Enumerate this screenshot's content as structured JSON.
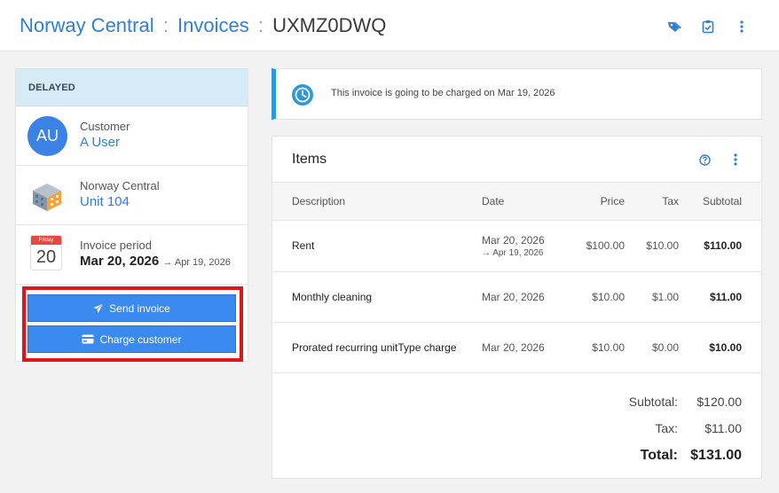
{
  "header": {
    "crumb_property": "Norway Central",
    "sep1": ":",
    "crumb_section": "Invoices",
    "sep2": ":",
    "invoice_id": "UXMZ0DWQ",
    "icons": [
      "tag-icon",
      "clipboard-check-icon",
      "more-vertical-icon"
    ]
  },
  "sidebar": {
    "status": "DELAYED",
    "customer": {
      "label": "Customer",
      "value": "A User",
      "initials": "AU"
    },
    "unit": {
      "label": "Norway Central",
      "value": "Unit 104"
    },
    "period": {
      "label": "Invoice period",
      "weekday": "Friday",
      "day": "20",
      "start": "Mar 20, 2026",
      "end": "→ Apr 19, 2026"
    },
    "send_button": "Send invoice",
    "charge_button": "Charge customer"
  },
  "notice": {
    "text": "This invoice is going to be charged on Mar 19, 2026"
  },
  "items": {
    "title": "Items",
    "columns": [
      "Description",
      "Date",
      "Price",
      "Tax",
      "Subtotal"
    ],
    "rows": [
      {
        "description": "Rent",
        "date": "Mar 20, 2026",
        "date_end": "→ Apr 19, 2026",
        "price": "$100.00",
        "tax": "$10.00",
        "subtotal": "$110.00"
      },
      {
        "description": "Monthly cleaning",
        "date": "Mar 20, 2026",
        "price": "$10.00",
        "tax": "$1.00",
        "subtotal": "$11.00"
      },
      {
        "description": "Prorated recurring unitType charge",
        "date": "Mar 20, 2026",
        "price": "$10.00",
        "tax": "$0.00",
        "subtotal": "$10.00"
      }
    ],
    "totals": {
      "subtotal_label": "Subtotal:",
      "subtotal": "$120.00",
      "tax_label": "Tax:",
      "tax": "$11.00",
      "total_label": "Total:",
      "total": "$131.00"
    }
  },
  "colors": {
    "accent": "#2f7fd8",
    "button": "#3b8aef",
    "status_bg": "#d7ebf7",
    "highlight": "#e0151b"
  }
}
